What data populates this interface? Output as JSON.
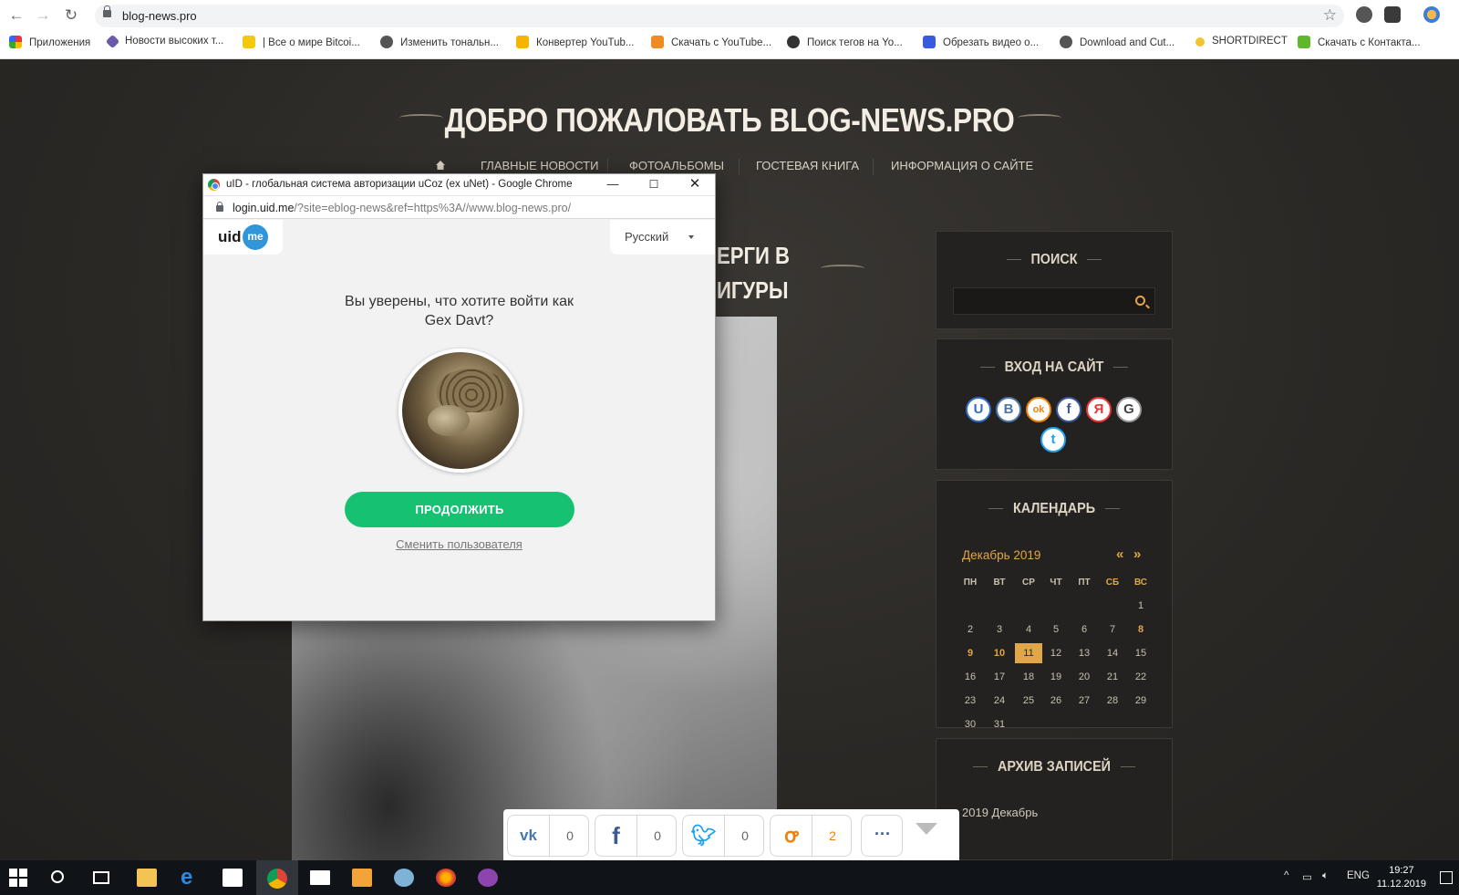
{
  "browser": {
    "url": "blog-news.pro",
    "bookmarks": [
      "Приложения",
      "Новости высоких т...",
      "| Все о мире Bitcoi...",
      "Изменить тональн...",
      "Конвертер YouTub...",
      "Скачать с YouTube...",
      "Поиск тегов на Yo...",
      "Обрезать видео о...",
      "Download and Cut...",
      "SHORTDIRECT",
      "Скачать с Контакта..."
    ]
  },
  "site": {
    "title": "ДОБРО ПОЖАЛОВАТЬ BLOG-NEWS.PRO",
    "nav": [
      "ГЛАВНЫЕ НОВОСТИ",
      "ФОТОАЛЬБОМЫ",
      "ГОСТЕВАЯ КНИГА",
      "ИНФОРМАЦИЯ О САЙТЕ"
    ],
    "article_title_lines": [
      "ЕРГИ В",
      "ИГУРЫ"
    ],
    "sidebar": {
      "search_title": "ПОИСК",
      "login_title": "ВХОД НА САЙТ",
      "social": [
        "U",
        "B",
        "ok",
        "f",
        "Я",
        "G",
        "t"
      ],
      "calendar_title": "КАЛЕНДАРЬ",
      "calendar_month": "Декабрь 2019",
      "calendar_prev": "«",
      "calendar_next": "»",
      "weekdays": [
        "ПН",
        "ВТ",
        "СР",
        "ЧТ",
        "ПТ",
        "СБ",
        "ВС"
      ],
      "archive_title": "АРХИВ ЗАПИСЕЙ",
      "archive_item": "2019 Декабрь"
    }
  },
  "share": {
    "vk_count": "0",
    "fb_count": "0",
    "tw_count": "0",
    "ok_count": "2",
    "more": "···"
  },
  "popup": {
    "window_title": "uID - глобальная система авторизации uCoz (ex uNet) - Google Chrome",
    "url_host": "login.uid.me",
    "url_path": "/?site=eblog-news&ref=https%3A//www.blog-news.pro/",
    "logo_text": "uid",
    "logo_badge": "me",
    "language": "Русский",
    "question_line1": "Вы уверены, что хотите войти как",
    "question_line2": "Gex Davt?",
    "continue_label": "ПРОДОЛЖИТЬ",
    "switch_user_label": "Сменить пользователя"
  },
  "taskbar": {
    "lang": "ENG",
    "time": "19:27",
    "date": "11.12.2019"
  }
}
